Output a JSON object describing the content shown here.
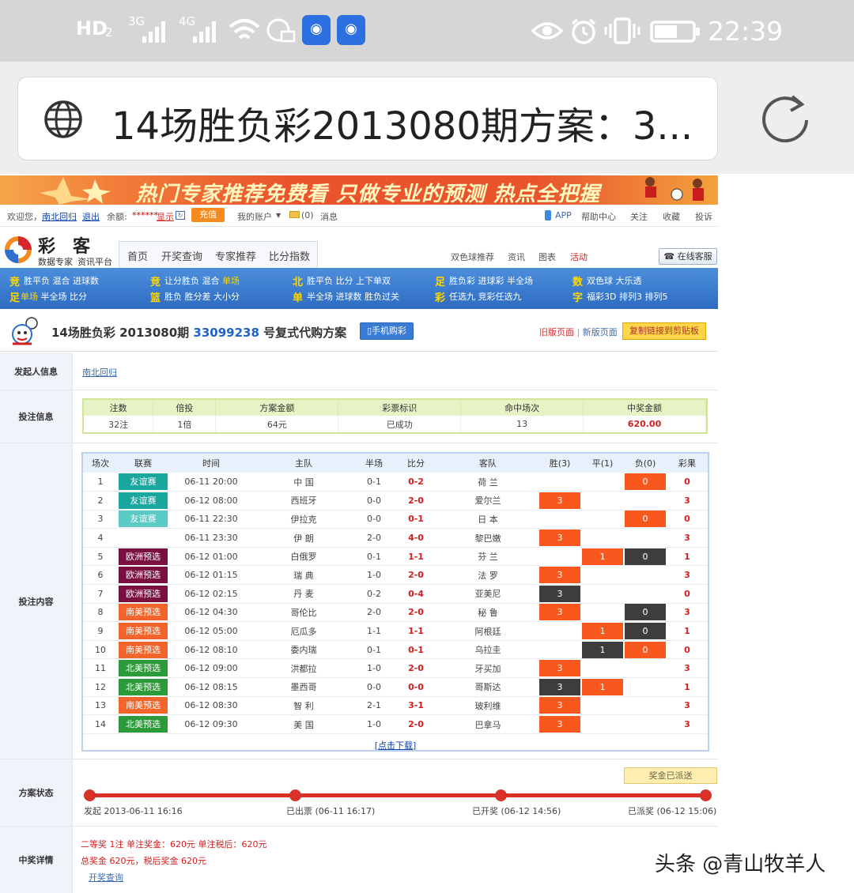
{
  "status_bar": {
    "hd": "HD",
    "sim": "2",
    "sig3g": "3G",
    "sig4g": "4G",
    "icons": [
      "wifi-icon",
      "data-icon",
      "app-icon",
      "app-icon"
    ],
    "right_icons": [
      "eye-icon",
      "alarm-icon",
      "vibrate-icon",
      "battery-icon"
    ],
    "time": "22:39"
  },
  "browser": {
    "title": "14场胜负彩2013080期方案：3...",
    "icon": "globe-icon",
    "reload": "reload-icon"
  },
  "banner": {
    "text": "热门专家推荐免费看 只做专业的预测 热点全把握"
  },
  "topbar": {
    "welcome": "欢迎您，",
    "user": "南北回归",
    "logout": "退出",
    "balance_label": "余额:",
    "balance": "******",
    "show": "显示",
    "recharge": "充值",
    "account": "我的账户",
    "msg_count": "(0)",
    "msg": "消息",
    "app": "APP",
    "help": "帮助中心",
    "follow": "关注",
    "fav": "收藏",
    "complain": "投诉"
  },
  "logo": {
    "brand": "彩客",
    "line1": "数据专家",
    "line2": "资讯平台"
  },
  "nav": {
    "tabs": [
      "首页",
      "开奖查询",
      "专家推荐",
      "比分指数"
    ],
    "right": [
      "双色球推荐",
      "资讯",
      "图表",
      "活动"
    ],
    "service": "在线客服"
  },
  "categories": [
    {
      "tag1": "竞",
      "tag2": "足",
      "row1": [
        "胜平负",
        "混合",
        "进球数"
      ],
      "row2_hl": "单场",
      "row2": [
        "半全场",
        "比分"
      ]
    },
    {
      "tag1": "竞",
      "tag2": "篮",
      "row1": [
        "让分胜负",
        "混合"
      ],
      "row1_hl": "单场",
      "row2": [
        "胜负",
        "胜分差",
        "大小分"
      ]
    },
    {
      "tag1": "北",
      "tag2": "单",
      "row1": [
        "胜平负",
        "比分",
        "上下单双"
      ],
      "row2": [
        "半全场",
        "进球数",
        "胜负过关"
      ]
    },
    {
      "tag1": "足",
      "tag2": "彩",
      "row1": [
        "胜负彩",
        "进球彩",
        "半全场"
      ],
      "row2": [
        "任选九",
        "竞彩任选九"
      ]
    },
    {
      "tag1": "数",
      "tag2": "字",
      "row1": [
        "双色球",
        "大乐透"
      ],
      "row2": [
        "福彩3D",
        "排列3",
        "排列5"
      ]
    }
  ],
  "plan": {
    "title_pre": "14场胜负彩 2013080期",
    "plan_id": "33099238",
    "title_post": "号复式代购方案",
    "mobile": "手机购彩",
    "old": "旧版页面",
    "sep": "|",
    "new": "新版页面",
    "copy": "复制链接到剪贴板"
  },
  "labels": {
    "initiator": "发起人信息",
    "betinfo": "投注信息",
    "content": "投注内容",
    "status": "方案状态",
    "prize": "中奖详情"
  },
  "initiator": "南北回归",
  "betinfo": {
    "headers": [
      "注数",
      "倍投",
      "方案金额",
      "彩票标识",
      "命中场次",
      "中奖金额"
    ],
    "values": [
      "32注",
      "1倍",
      "64元",
      "已成功",
      "13",
      "620.00"
    ]
  },
  "bet": {
    "headers": [
      "场次",
      "联赛",
      "时间",
      "主队",
      "半场",
      "比分",
      "客队",
      "胜(3)",
      "平(1)",
      "负(0)",
      "彩果"
    ],
    "rows": [
      {
        "no": "1",
        "league": "友谊赛",
        "lc": "#1aa7a0",
        "time": "06-11 20:00",
        "home": "中 国",
        "half": "0-1",
        "score": "0-2",
        "away": "荷 兰",
        "w": "",
        "wc": "",
        "d": "",
        "dc": "",
        "l": "0",
        "lcc": "or",
        "res": "0"
      },
      {
        "no": "2",
        "league": "友谊赛",
        "lc": "#1aa7a0",
        "time": "06-12 08:00",
        "home": "西班牙",
        "half": "0-0",
        "score": "2-0",
        "away": "爱尔兰",
        "w": "3",
        "wc": "or",
        "d": "",
        "dc": "",
        "l": "",
        "lcc": "",
        "res": "3"
      },
      {
        "no": "3",
        "league": "友谊赛",
        "lc": "#5bc9c4",
        "time": "06-11 22:30",
        "home": "伊拉克",
        "half": "0-0",
        "score": "0-1",
        "away": "日 本",
        "w": "",
        "wc": "",
        "d": "",
        "dc": "",
        "l": "0",
        "lcc": "or",
        "res": "0"
      },
      {
        "no": "4",
        "league": "",
        "lc": "",
        "time": "06-11 23:30",
        "home": "伊 朗",
        "half": "2-0",
        "score": "4-0",
        "away": "黎巴嫩",
        "w": "3",
        "wc": "or",
        "d": "",
        "dc": "",
        "l": "",
        "lcc": "",
        "res": "3"
      },
      {
        "no": "5",
        "league": "欧洲预选",
        "lc": "#7a1040",
        "time": "06-12 01:00",
        "home": "白俄罗",
        "half": "0-1",
        "score": "1-1",
        "away": "芬 兰",
        "w": "",
        "wc": "",
        "d": "1",
        "dc": "or",
        "l": "0",
        "lcc": "dk",
        "res": "1"
      },
      {
        "no": "6",
        "league": "欧洲预选",
        "lc": "#7a1040",
        "time": "06-12 01:15",
        "home": "瑞 典",
        "half": "1-0",
        "score": "2-0",
        "away": "法 罗",
        "w": "3",
        "wc": "or",
        "d": "",
        "dc": "",
        "l": "",
        "lcc": "",
        "res": "3"
      },
      {
        "no": "7",
        "league": "欧洲预选",
        "lc": "#7a1040",
        "time": "06-12 02:15",
        "home": "丹 麦",
        "half": "0-2",
        "score": "0-4",
        "away": "亚美尼",
        "w": "3",
        "wc": "dk",
        "d": "",
        "dc": "",
        "l": "",
        "lcc": "",
        "res": "0"
      },
      {
        "no": "8",
        "league": "南美预选",
        "lc": "#f3642b",
        "time": "06-12 04:30",
        "home": "哥伦比",
        "half": "2-0",
        "score": "2-0",
        "away": "秘 鲁",
        "w": "3",
        "wc": "or",
        "d": "",
        "dc": "",
        "l": "0",
        "lcc": "dk",
        "res": "3"
      },
      {
        "no": "9",
        "league": "南美预选",
        "lc": "#f3642b",
        "time": "06-12 05:00",
        "home": "厄瓜多",
        "half": "1-1",
        "score": "1-1",
        "away": "阿根廷",
        "w": "",
        "wc": "",
        "d": "1",
        "dc": "or",
        "l": "0",
        "lcc": "dk",
        "res": "1"
      },
      {
        "no": "10",
        "league": "南美预选",
        "lc": "#f3642b",
        "time": "06-12 08:10",
        "home": "委内瑞",
        "half": "0-1",
        "score": "0-1",
        "away": "乌拉圭",
        "w": "",
        "wc": "",
        "d": "1",
        "dc": "dk",
        "l": "0",
        "lcc": "or",
        "res": "0"
      },
      {
        "no": "11",
        "league": "北美预选",
        "lc": "#2c9a3a",
        "time": "06-12 09:00",
        "home": "洪都拉",
        "half": "1-0",
        "score": "2-0",
        "away": "牙买加",
        "w": "3",
        "wc": "or",
        "d": "",
        "dc": "",
        "l": "",
        "lcc": "",
        "res": "3"
      },
      {
        "no": "12",
        "league": "北美预选",
        "lc": "#2c9a3a",
        "time": "06-12 08:15",
        "home": "墨西哥",
        "half": "0-0",
        "score": "0-0",
        "away": "哥斯达",
        "w": "3",
        "wc": "dk",
        "d": "1",
        "dc": "or",
        "l": "",
        "lcc": "",
        "res": "1"
      },
      {
        "no": "13",
        "league": "南美预选",
        "lc": "#f3642b",
        "time": "06-12 08:30",
        "home": "智 利",
        "half": "2-1",
        "score": "3-1",
        "away": "玻利维",
        "w": "3",
        "wc": "or",
        "d": "",
        "dc": "",
        "l": "",
        "lcc": "",
        "res": "3"
      },
      {
        "no": "14",
        "league": "北美预选",
        "lc": "#2c9a3a",
        "time": "06-12 09:30",
        "home": "美 国",
        "half": "1-0",
        "score": "2-0",
        "away": "巴拿马",
        "w": "3",
        "wc": "or",
        "d": "",
        "dc": "",
        "l": "",
        "lcc": "",
        "res": "3"
      }
    ],
    "download": "[点击下载]"
  },
  "status": {
    "badge": "奖金已派送",
    "steps": [
      "发起 2013-06-11 16:16",
      "已出票 (06-11 16:17)",
      "已开奖 (06-12 14:56)",
      "已派奖 (06-12 15:06)"
    ]
  },
  "prize": {
    "line1": "二等奖 1注 单注奖金：620元 单注税后：620元",
    "line2": "总奖金 620元，税后奖金 620元",
    "query": "开奖查询"
  },
  "watermark": "头条 @青山牧羊人"
}
